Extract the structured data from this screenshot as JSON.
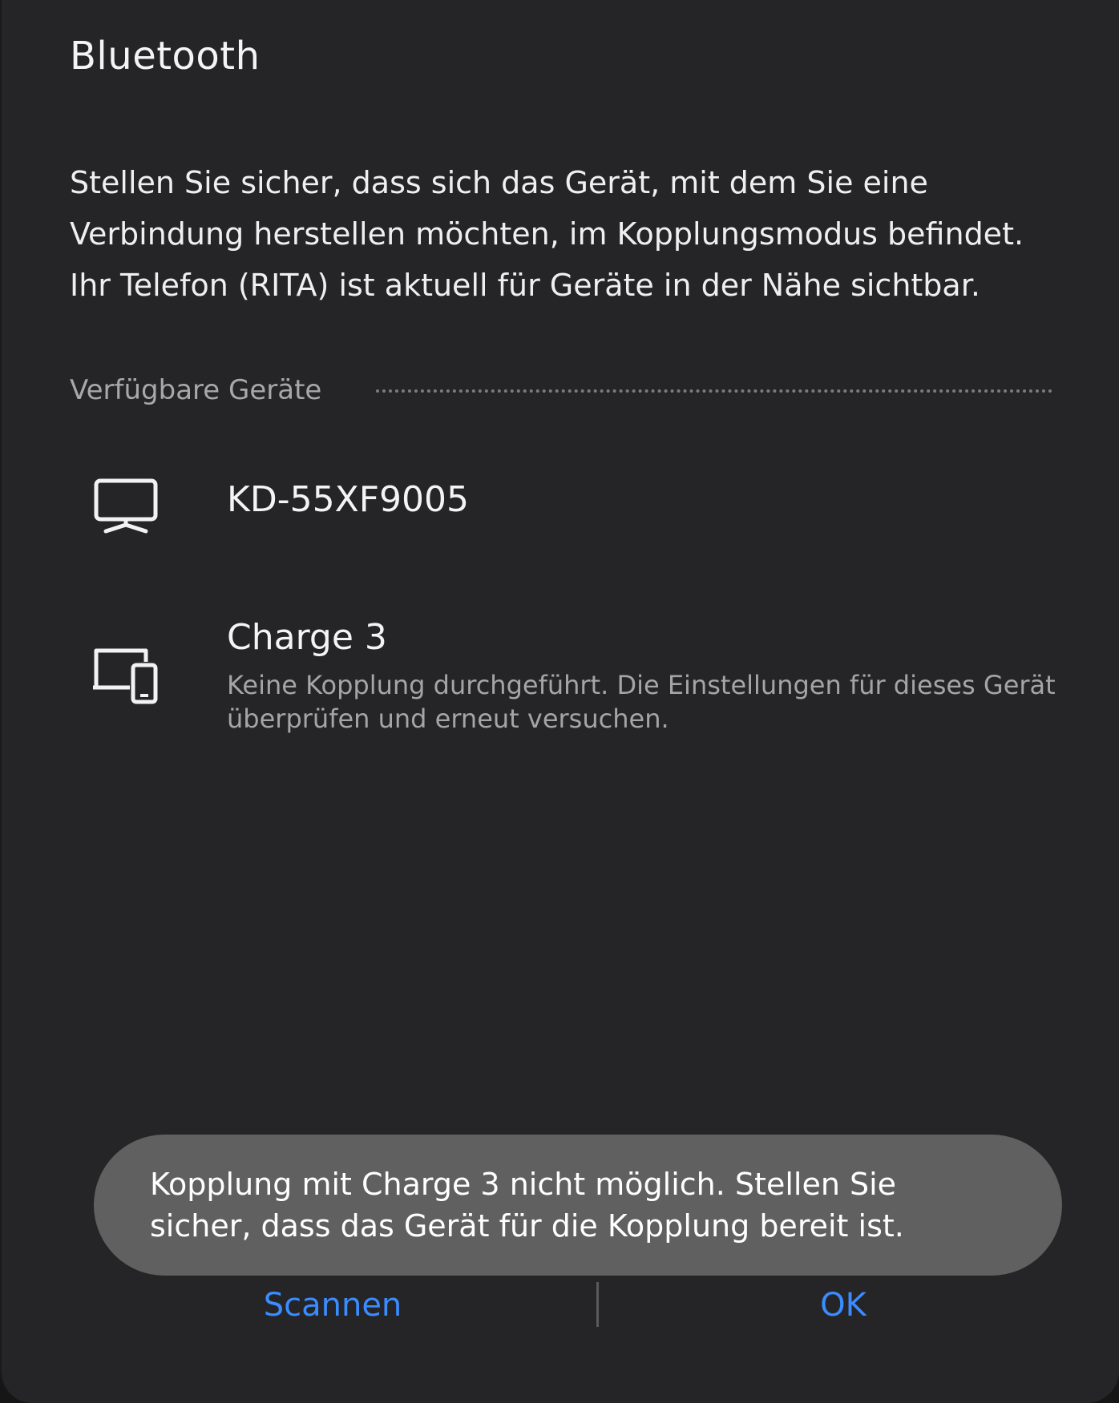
{
  "dialog": {
    "title": "Bluetooth",
    "description": "Stellen Sie sicher, dass sich das Gerät, mit dem Sie eine Verbindung herstellen möchten, im Kopplungsmodus befindet. Ihr Telefon (RITA) ist aktuell für Geräte in der Nähe sichtbar."
  },
  "section": {
    "label": "Verfügbare Geräte"
  },
  "devices": [
    {
      "name": "KD-55XF9005",
      "icon": "tv-icon",
      "status": ""
    },
    {
      "name": "Charge 3",
      "icon": "devices-icon",
      "status": "Keine Kopplung durchgeführt. Die Einstellungen für dieses Gerät überprüfen und erneut versuchen."
    }
  ],
  "toast": {
    "message": "Kopplung mit Charge 3 nicht möglich. Stellen Sie sicher, dass das Gerät für die Kopplung bereit ist."
  },
  "buttons": {
    "scan_label": "Scannen",
    "ok_label": "OK"
  },
  "colors": {
    "background": "#252527",
    "toast": "#606060",
    "accent": "#3a8cff",
    "secondary_text": "#a5a5a5"
  }
}
